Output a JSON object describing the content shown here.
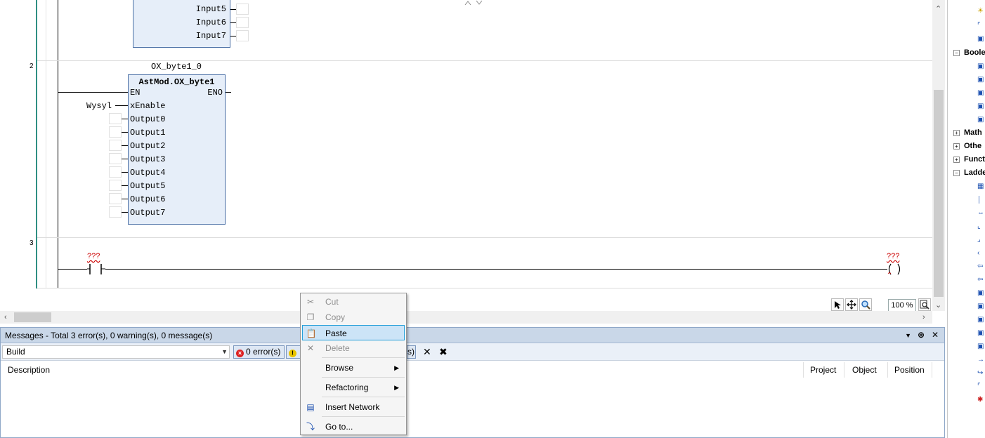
{
  "editor": {
    "networks": [
      {
        "number": "2"
      },
      {
        "number": "3"
      }
    ],
    "fb_top": {
      "inputs": [
        "Input5",
        "Input6",
        "Input7"
      ]
    },
    "fb_main": {
      "instance": "OX_byte1_0",
      "type": "AstMod.OX_byte1",
      "en": "EN",
      "eno": "ENO",
      "enable_var": "Wysyl",
      "pins": [
        "xEnable",
        "Output0",
        "Output1",
        "Output2",
        "Output3",
        "Output4",
        "Output5",
        "Output6",
        "Output7"
      ]
    },
    "contact_label": "???",
    "coil_label": "???",
    "zoom": "100 %"
  },
  "messages": {
    "title": "Messages - Total 3 error(s), 0 warning(s), 0 message(s)",
    "build": "Build",
    "errors": "0 error(s)",
    "messages_partial": "s)",
    "columns": {
      "description": "Description",
      "project": "Project",
      "object": "Object",
      "position": "Position"
    }
  },
  "toolbox": {
    "categories": [
      "Boole",
      "Math",
      "Othe",
      "Funct",
      "Ladde"
    ]
  },
  "context_menu": {
    "cut": "Cut",
    "copy": "Copy",
    "paste": "Paste",
    "delete": "Delete",
    "browse": "Browse",
    "refactoring": "Refactoring",
    "insert_network": "Insert Network",
    "goto": "Go to..."
  },
  "colors": {
    "accent_rail": "#2f8f82",
    "fb_fill": "#e6eef9",
    "error_red": "#cc0000",
    "menu_highlight": "#cce4f7"
  }
}
